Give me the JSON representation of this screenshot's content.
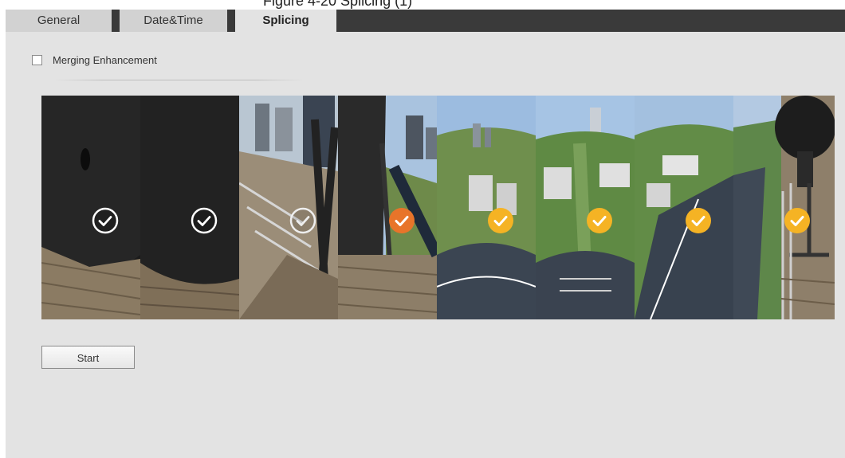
{
  "header": {
    "caption": "Figure 4-20 Splicing (1)"
  },
  "tabs": [
    {
      "label": "General",
      "active": false
    },
    {
      "label": "Date&Time",
      "active": false
    },
    {
      "label": "Splicing",
      "active": true
    }
  ],
  "merging": {
    "label": "Merging Enhancement",
    "checked": false
  },
  "markers": [
    {
      "state": "unselected",
      "color": "#ffffff",
      "icon": "check-circle-outline-icon"
    },
    {
      "state": "unselected",
      "color": "#ffffff",
      "icon": "check-circle-outline-icon"
    },
    {
      "state": "unselected",
      "color": "#ffffff",
      "icon": "check-circle-outline-icon"
    },
    {
      "state": "current",
      "color": "#e8742a",
      "icon": "check-circle-filled-icon"
    },
    {
      "state": "selected",
      "color": "#f5b324",
      "icon": "check-circle-filled-icon"
    },
    {
      "state": "selected",
      "color": "#f5b324",
      "icon": "check-circle-filled-icon"
    },
    {
      "state": "selected",
      "color": "#f5b324",
      "icon": "check-circle-filled-icon"
    },
    {
      "state": "selected",
      "color": "#f5b324",
      "icon": "check-circle-filled-icon"
    }
  ],
  "actions": {
    "start_label": "Start"
  }
}
